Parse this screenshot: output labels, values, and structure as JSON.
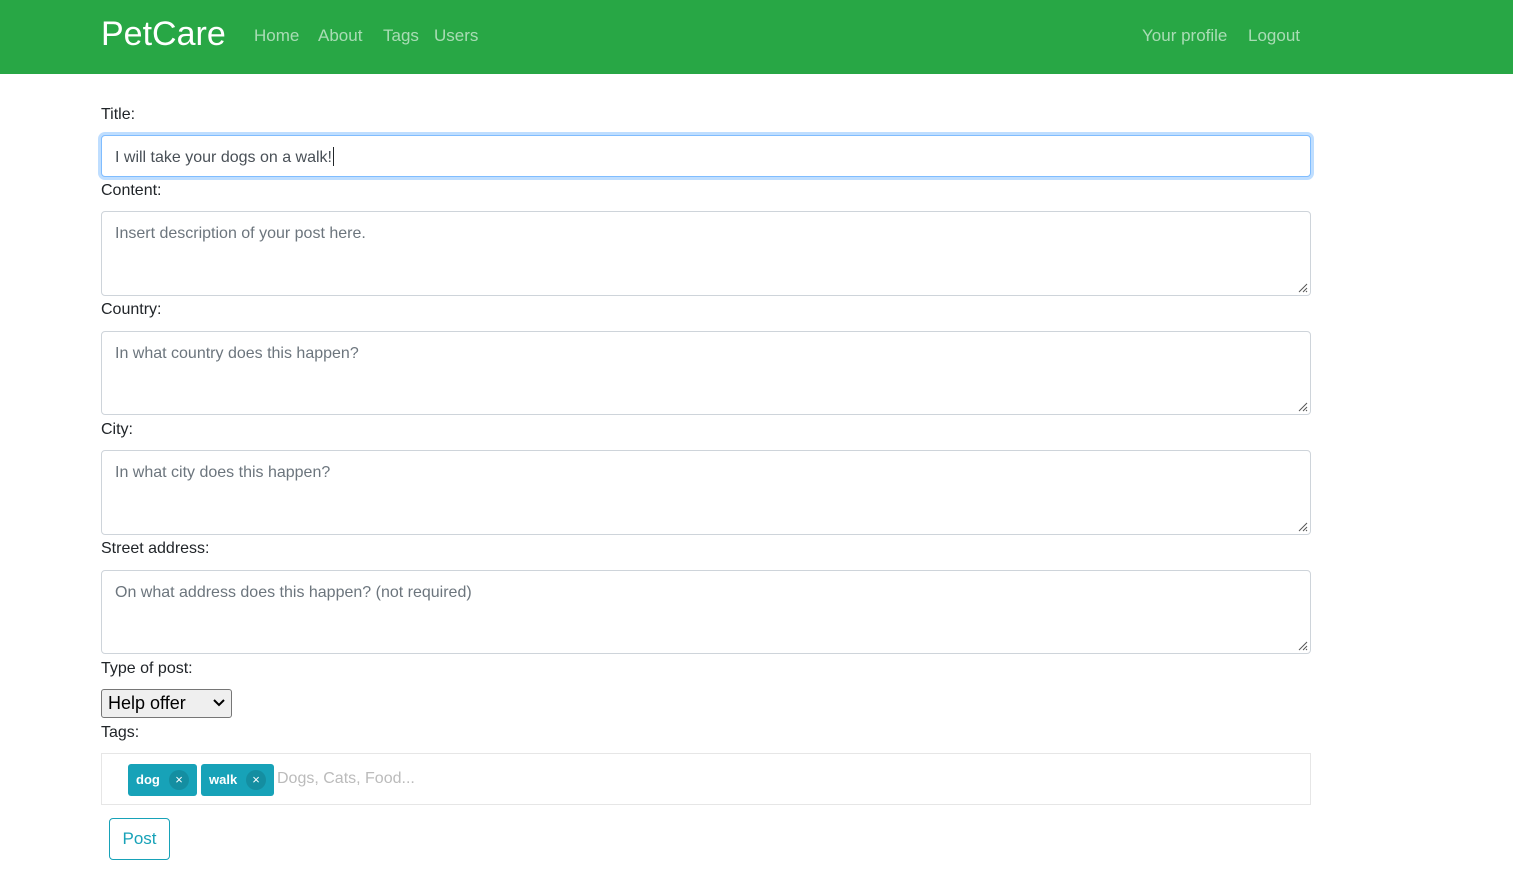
{
  "nav": {
    "brand": "PetCare",
    "links": [
      "Home",
      "About",
      "Tags",
      "Users"
    ],
    "right_links": [
      "Your profile",
      "Logout"
    ]
  },
  "form": {
    "title_label": "Title:",
    "title_value": "I will take your dogs on a walk!",
    "content_label": "Content:",
    "content_placeholder": "Insert description of your post here.",
    "country_label": "Country:",
    "country_placeholder": "In what country does this happen?",
    "city_label": "City:",
    "city_placeholder": "In what city does this happen?",
    "street_label": "Street address:",
    "street_placeholder": "On what address does this happen? (not required)",
    "type_label": "Type of post:",
    "type_selected": "Help offer",
    "tags_label": "Tags:",
    "tags": [
      "dog",
      "walk"
    ],
    "tag_remove": "×",
    "tags_placeholder": "Dogs, Cats, Food...",
    "submit_label": "Post"
  },
  "colors": {
    "navbar": "#28a745",
    "tag": "#17a2b8",
    "focus": "#80bdff"
  }
}
